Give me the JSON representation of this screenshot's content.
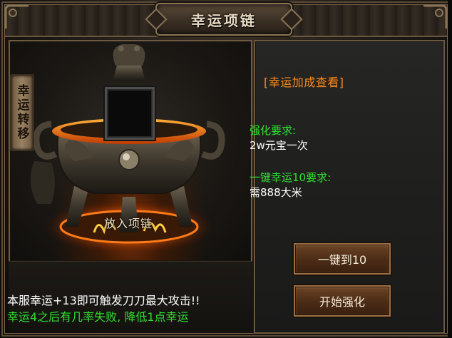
{
  "window": {
    "title": "幸运项链"
  },
  "side_tab": {
    "label": "幸运转移"
  },
  "slot": {
    "label": "放入项链"
  },
  "info": {
    "link_label": "[幸运加成查看]",
    "strengthen_req_label": "强化要求:",
    "strengthen_req_value": "2w元宝一次",
    "onekey_req_label": "一键幸运10要求:",
    "onekey_req_value": "需888大米"
  },
  "buttons": {
    "onekey_label": "一键到10",
    "start_label": "开始强化"
  },
  "notes": {
    "line1": "本服幸运+13即可触发刀刀最大攻击!!",
    "line2": "幸运4之后有几率失败, 降低1点幸运"
  },
  "colors": {
    "accent_orange": "#ff8a1c",
    "req_green": "#2fe02f",
    "fire": "#ff5a0a"
  }
}
